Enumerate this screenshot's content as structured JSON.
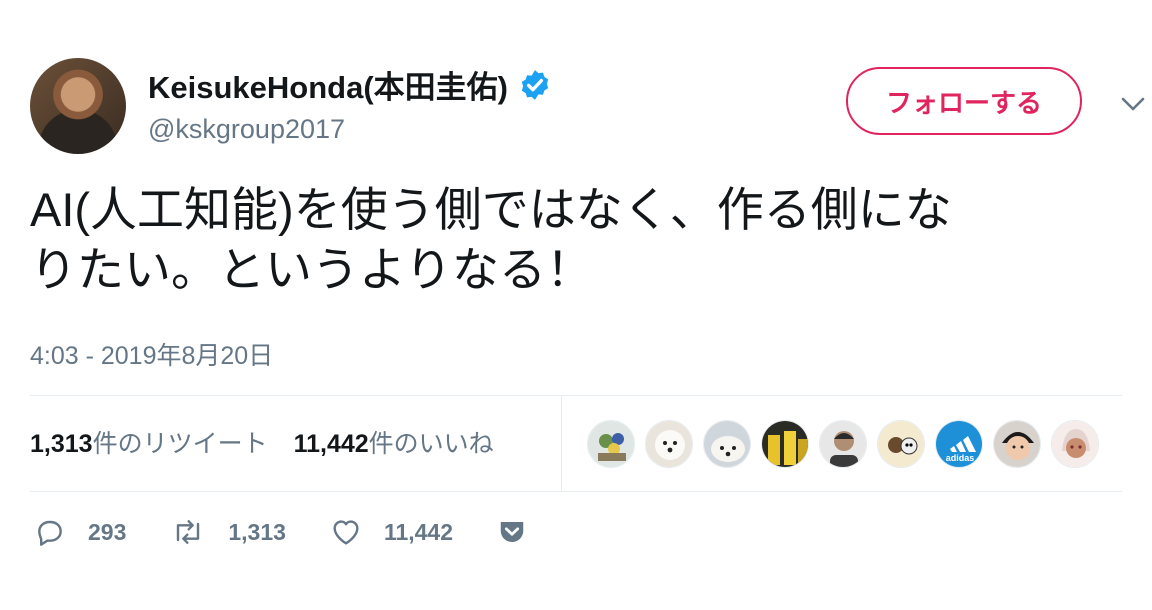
{
  "profile": {
    "name": "KeisukeHonda(本田圭佑)",
    "handle": "@kskgroup2017",
    "verified": true,
    "follow_label": "フォローする"
  },
  "tweet": {
    "text_line1": "AI(人工知能)を使う側ではなく、作る側にな",
    "text_line2": "りたい。というよりなる！",
    "timestamp": "4:03 - 2019年8月20日"
  },
  "stats": {
    "retweet_count": "1,313",
    "retweet_label": "件のリツイート",
    "like_count": "11,442",
    "like_label": "件のいいね"
  },
  "likers": [
    {
      "icon": "flowers-avatar"
    },
    {
      "icon": "white-dog-avatar"
    },
    {
      "icon": "white-dog-avatar"
    },
    {
      "icon": "soccer-avatar"
    },
    {
      "icon": "person-avatar"
    },
    {
      "icon": "cartoon-bear-avatar"
    },
    {
      "icon": "adidas-logo-avatar",
      "text": "adidas"
    },
    {
      "icon": "baby-avatar"
    },
    {
      "icon": "anime-girl-avatar"
    }
  ],
  "actions": {
    "reply_count": "293",
    "retweet_count": "1,313",
    "like_count": "11,442"
  },
  "colors": {
    "follow_accent": "#e0245e",
    "verified_blue": "#1da1f2",
    "muted_text": "#657786"
  }
}
